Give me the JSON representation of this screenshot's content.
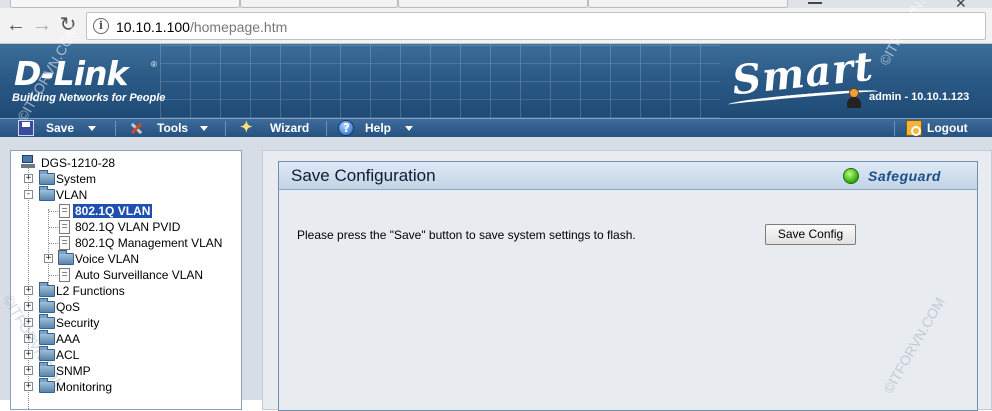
{
  "browser": {
    "url_host": "10.10.1.100",
    "url_path": "/homepage.htm"
  },
  "header": {
    "logo_text": "D-Link",
    "logo_tagline": "Building Networks for People",
    "product_name": "Smart",
    "user_info": "admin - 10.10.1.123"
  },
  "menu": {
    "save": "Save",
    "tools": "Tools",
    "wizard": "Wizard",
    "help": "Help",
    "logout": "Logout"
  },
  "tree": {
    "root": "DGS-1210-28",
    "items": [
      {
        "label": "System",
        "type": "folder",
        "expander": "+"
      },
      {
        "label": "VLAN",
        "type": "folder",
        "expander": "-"
      },
      {
        "label": "802.1Q VLAN",
        "type": "page",
        "selected": true
      },
      {
        "label": "802.1Q VLAN PVID",
        "type": "page"
      },
      {
        "label": "802.1Q Management VLAN",
        "type": "page"
      },
      {
        "label": "Voice VLAN",
        "type": "folder",
        "expander": "+"
      },
      {
        "label": "Auto Surveillance VLAN",
        "type": "page"
      },
      {
        "label": "L2 Functions",
        "type": "folder",
        "expander": "+"
      },
      {
        "label": "QoS",
        "type": "folder",
        "expander": "+"
      },
      {
        "label": "Security",
        "type": "folder",
        "expander": "+"
      },
      {
        "label": "AAA",
        "type": "folder",
        "expander": "+"
      },
      {
        "label": "ACL",
        "type": "folder",
        "expander": "+"
      },
      {
        "label": "SNMP",
        "type": "folder",
        "expander": "+"
      },
      {
        "label": "Monitoring",
        "type": "folder",
        "expander": "+"
      }
    ]
  },
  "panel": {
    "title": "Save Configuration",
    "safeguard_label": "Safeguard",
    "message": "Please press the \"Save\" button to save system settings to flash.",
    "save_config_button": "Save Config"
  },
  "watermark": "©ITFORVN.COM",
  "colors": {
    "header_blue": "#2b5a86",
    "menubar_blue": "#26527f",
    "selection_blue": "#1f4fb0",
    "safeguard_green": "#2fa80f"
  }
}
